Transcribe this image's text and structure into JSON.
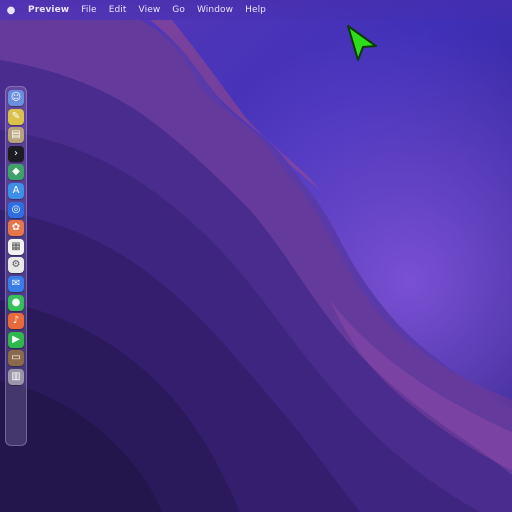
{
  "menubar": {
    "apple_icon": "apple-logo-icon",
    "items": [
      {
        "label": "Preview",
        "kind": "app"
      },
      {
        "label": "File"
      },
      {
        "label": "Edit"
      },
      {
        "label": "View"
      },
      {
        "label": "Go"
      },
      {
        "label": "Window"
      },
      {
        "label": "Help"
      }
    ]
  },
  "dock": {
    "icons": [
      {
        "name": "finder-icon",
        "glyph": "☺",
        "bg": "#6b8fe0"
      },
      {
        "name": "notes-icon",
        "glyph": "✎",
        "bg": "#d9c24a"
      },
      {
        "name": "preview-icon",
        "glyph": "▤",
        "bg": "#b8a27a"
      },
      {
        "name": "terminal-icon",
        "glyph": "›",
        "bg": "#1c1c24"
      },
      {
        "name": "maps-icon",
        "glyph": "◆",
        "bg": "#3da36b"
      },
      {
        "name": "app-store-icon",
        "glyph": "A",
        "bg": "#3f8ee8"
      },
      {
        "name": "safari-icon",
        "glyph": "◎",
        "bg": "#2d6fe0"
      },
      {
        "name": "photos-icon",
        "glyph": "✿",
        "bg": "#e8754a"
      },
      {
        "name": "calendar-icon",
        "glyph": "▦",
        "bg": "#f2f2f2"
      },
      {
        "name": "system-settings-icon",
        "glyph": "⚙",
        "bg": "#e8e8e8"
      },
      {
        "name": "mail-icon",
        "glyph": "✉",
        "bg": "#3a7de8"
      },
      {
        "name": "messages-icon",
        "glyph": "●",
        "bg": "#34c05a"
      },
      {
        "name": "music-icon",
        "glyph": "♪",
        "bg": "#e86a3a"
      },
      {
        "name": "facetime-icon",
        "glyph": "▶",
        "bg": "#2fb84e"
      },
      {
        "name": "books-icon",
        "glyph": "▭",
        "bg": "#8a6a4a"
      },
      {
        "name": "trash-icon",
        "glyph": "▥",
        "bg": "#9a95a8"
      }
    ]
  },
  "colors": {
    "cursor": "#2fdc1a",
    "wallpaper_top": "#4b35c8",
    "wallpaper_bottom": "#1a1040"
  }
}
